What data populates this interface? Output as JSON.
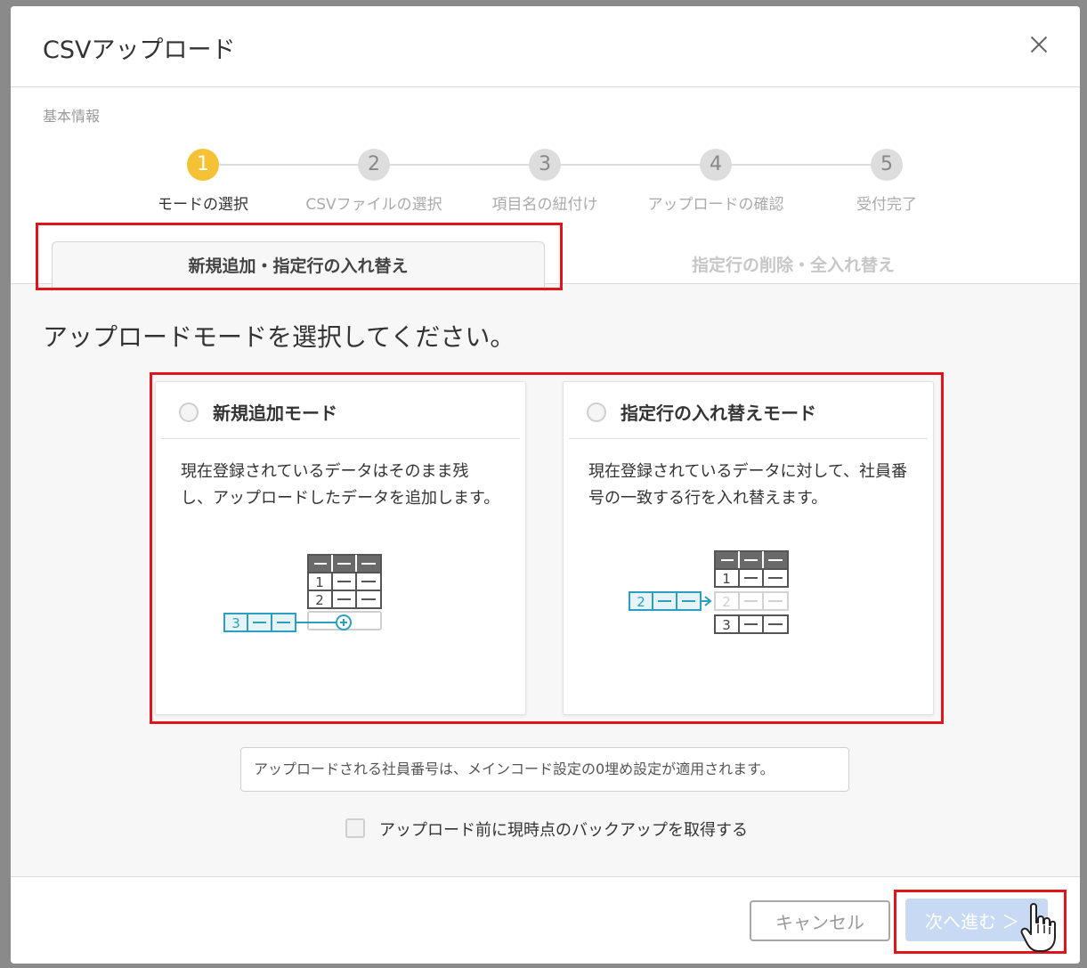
{
  "modal": {
    "title": "CSVアップロード",
    "section_label": "基本情報"
  },
  "steps": [
    {
      "number": "1",
      "label": "モードの選択",
      "active": true
    },
    {
      "number": "2",
      "label": "CSVファイルの選択",
      "active": false
    },
    {
      "number": "3",
      "label": "項目名の紐付け",
      "active": false
    },
    {
      "number": "4",
      "label": "アップロードの確認",
      "active": false
    },
    {
      "number": "5",
      "label": "受付完了",
      "active": false
    }
  ],
  "tabs": [
    {
      "label": "新規追加・指定行の入れ替え",
      "active": true
    },
    {
      "label": "指定行の削除・全入れ替え",
      "active": false
    }
  ],
  "prompt": "アップロードモードを選択してください。",
  "modes": [
    {
      "title": "新規追加モード",
      "description": "現在登録されているデータはそのまま残し、アップロードしたデータを追加します。",
      "selected": false,
      "illustration": {
        "table_rows": [
          "1",
          "2"
        ],
        "new_row": "3"
      }
    },
    {
      "title": "指定行の入れ替えモード",
      "description": "現在登録されているデータに対して、社員番号の一致する行を入れ替えます。",
      "selected": false,
      "illustration": {
        "table_rows": [
          "1",
          "2",
          "3"
        ],
        "new_row": "2"
      }
    }
  ],
  "notice": "アップロードされる社員番号は、メインコード設定の0埋め設定が適用されます。",
  "backup": {
    "label": "アップロード前に現時点のバックアップを取得する",
    "checked": false
  },
  "footer": {
    "cancel_label": "キャンセル",
    "next_label": "次へ進む ＞"
  },
  "colors": {
    "accent": "#f4c234",
    "highlight": "#e0141b",
    "illus_blue": "#2a9fbf",
    "next_disabled": "#c8d9f3"
  }
}
